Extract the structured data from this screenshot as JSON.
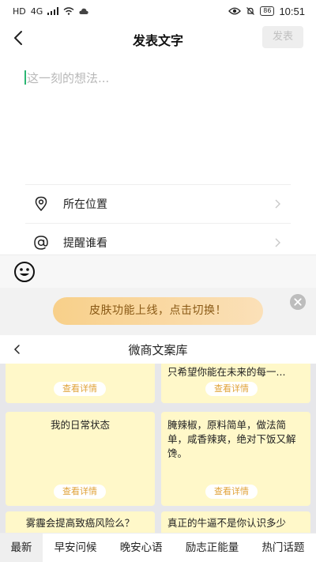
{
  "status_bar": {
    "left_icons": [
      "HD",
      "4G"
    ],
    "battery": "86",
    "time": "10:51"
  },
  "header": {
    "title": "发表文字",
    "publish_label": "发表"
  },
  "compose": {
    "placeholder": "这一刻的想法..."
  },
  "options": [
    {
      "label": "所在位置",
      "icon": "location-pin-icon"
    },
    {
      "label": "提醒谁看",
      "icon": "at-sign-icon"
    }
  ],
  "emoji_icon": "smiley-face-icon",
  "skin_banner": {
    "label": "皮肤功能上线，点击切换！",
    "close_icon": "close-circle-icon"
  },
  "library": {
    "title": "微商文案库",
    "detail_label": "查看详情",
    "cards": [
      {
        "text": ""
      },
      {
        "text": "只希望你能在未来的每一..."
      },
      {
        "text": "我的日常状态"
      },
      {
        "text": "腌辣椒，原料简单，做法简单，咸香辣爽，绝对下饭又解馋。"
      },
      {
        "text": "雾霾会提高致癌风险么？"
      },
      {
        "text": "真正的牛逼不是你认识多少"
      }
    ]
  },
  "tabs": [
    "最新",
    "早安问候",
    "晚安心语",
    "励志正能量",
    "热门话题"
  ],
  "colors": {
    "card_bg": "#fff8c9",
    "accent_gold": "#e0a33a",
    "caret_green": "#2bb673",
    "banner_text": "#8a5a16"
  }
}
